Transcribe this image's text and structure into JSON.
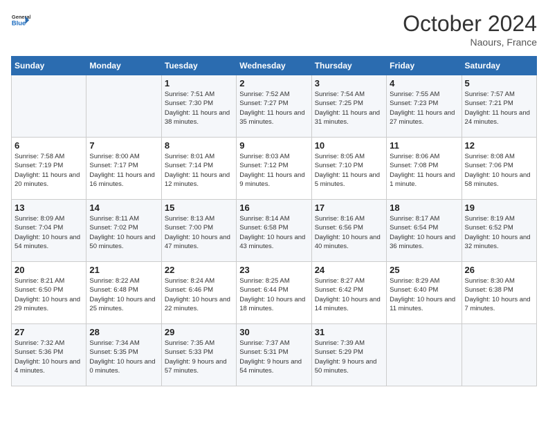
{
  "header": {
    "logo_line1": "General",
    "logo_line2": "Blue",
    "month": "October 2024",
    "location": "Naours, France"
  },
  "days_of_week": [
    "Sunday",
    "Monday",
    "Tuesday",
    "Wednesday",
    "Thursday",
    "Friday",
    "Saturday"
  ],
  "weeks": [
    [
      {
        "day": "",
        "sunrise": "",
        "sunset": "",
        "daylight": ""
      },
      {
        "day": "",
        "sunrise": "",
        "sunset": "",
        "daylight": ""
      },
      {
        "day": "1",
        "sunrise": "Sunrise: 7:51 AM",
        "sunset": "Sunset: 7:30 PM",
        "daylight": "Daylight: 11 hours and 38 minutes."
      },
      {
        "day": "2",
        "sunrise": "Sunrise: 7:52 AM",
        "sunset": "Sunset: 7:27 PM",
        "daylight": "Daylight: 11 hours and 35 minutes."
      },
      {
        "day": "3",
        "sunrise": "Sunrise: 7:54 AM",
        "sunset": "Sunset: 7:25 PM",
        "daylight": "Daylight: 11 hours and 31 minutes."
      },
      {
        "day": "4",
        "sunrise": "Sunrise: 7:55 AM",
        "sunset": "Sunset: 7:23 PM",
        "daylight": "Daylight: 11 hours and 27 minutes."
      },
      {
        "day": "5",
        "sunrise": "Sunrise: 7:57 AM",
        "sunset": "Sunset: 7:21 PM",
        "daylight": "Daylight: 11 hours and 24 minutes."
      }
    ],
    [
      {
        "day": "6",
        "sunrise": "Sunrise: 7:58 AM",
        "sunset": "Sunset: 7:19 PM",
        "daylight": "Daylight: 11 hours and 20 minutes."
      },
      {
        "day": "7",
        "sunrise": "Sunrise: 8:00 AM",
        "sunset": "Sunset: 7:17 PM",
        "daylight": "Daylight: 11 hours and 16 minutes."
      },
      {
        "day": "8",
        "sunrise": "Sunrise: 8:01 AM",
        "sunset": "Sunset: 7:14 PM",
        "daylight": "Daylight: 11 hours and 12 minutes."
      },
      {
        "day": "9",
        "sunrise": "Sunrise: 8:03 AM",
        "sunset": "Sunset: 7:12 PM",
        "daylight": "Daylight: 11 hours and 9 minutes."
      },
      {
        "day": "10",
        "sunrise": "Sunrise: 8:05 AM",
        "sunset": "Sunset: 7:10 PM",
        "daylight": "Daylight: 11 hours and 5 minutes."
      },
      {
        "day": "11",
        "sunrise": "Sunrise: 8:06 AM",
        "sunset": "Sunset: 7:08 PM",
        "daylight": "Daylight: 11 hours and 1 minute."
      },
      {
        "day": "12",
        "sunrise": "Sunrise: 8:08 AM",
        "sunset": "Sunset: 7:06 PM",
        "daylight": "Daylight: 10 hours and 58 minutes."
      }
    ],
    [
      {
        "day": "13",
        "sunrise": "Sunrise: 8:09 AM",
        "sunset": "Sunset: 7:04 PM",
        "daylight": "Daylight: 10 hours and 54 minutes."
      },
      {
        "day": "14",
        "sunrise": "Sunrise: 8:11 AM",
        "sunset": "Sunset: 7:02 PM",
        "daylight": "Daylight: 10 hours and 50 minutes."
      },
      {
        "day": "15",
        "sunrise": "Sunrise: 8:13 AM",
        "sunset": "Sunset: 7:00 PM",
        "daylight": "Daylight: 10 hours and 47 minutes."
      },
      {
        "day": "16",
        "sunrise": "Sunrise: 8:14 AM",
        "sunset": "Sunset: 6:58 PM",
        "daylight": "Daylight: 10 hours and 43 minutes."
      },
      {
        "day": "17",
        "sunrise": "Sunrise: 8:16 AM",
        "sunset": "Sunset: 6:56 PM",
        "daylight": "Daylight: 10 hours and 40 minutes."
      },
      {
        "day": "18",
        "sunrise": "Sunrise: 8:17 AM",
        "sunset": "Sunset: 6:54 PM",
        "daylight": "Daylight: 10 hours and 36 minutes."
      },
      {
        "day": "19",
        "sunrise": "Sunrise: 8:19 AM",
        "sunset": "Sunset: 6:52 PM",
        "daylight": "Daylight: 10 hours and 32 minutes."
      }
    ],
    [
      {
        "day": "20",
        "sunrise": "Sunrise: 8:21 AM",
        "sunset": "Sunset: 6:50 PM",
        "daylight": "Daylight: 10 hours and 29 minutes."
      },
      {
        "day": "21",
        "sunrise": "Sunrise: 8:22 AM",
        "sunset": "Sunset: 6:48 PM",
        "daylight": "Daylight: 10 hours and 25 minutes."
      },
      {
        "day": "22",
        "sunrise": "Sunrise: 8:24 AM",
        "sunset": "Sunset: 6:46 PM",
        "daylight": "Daylight: 10 hours and 22 minutes."
      },
      {
        "day": "23",
        "sunrise": "Sunrise: 8:25 AM",
        "sunset": "Sunset: 6:44 PM",
        "daylight": "Daylight: 10 hours and 18 minutes."
      },
      {
        "day": "24",
        "sunrise": "Sunrise: 8:27 AM",
        "sunset": "Sunset: 6:42 PM",
        "daylight": "Daylight: 10 hours and 14 minutes."
      },
      {
        "day": "25",
        "sunrise": "Sunrise: 8:29 AM",
        "sunset": "Sunset: 6:40 PM",
        "daylight": "Daylight: 10 hours and 11 minutes."
      },
      {
        "day": "26",
        "sunrise": "Sunrise: 8:30 AM",
        "sunset": "Sunset: 6:38 PM",
        "daylight": "Daylight: 10 hours and 7 minutes."
      }
    ],
    [
      {
        "day": "27",
        "sunrise": "Sunrise: 7:32 AM",
        "sunset": "Sunset: 5:36 PM",
        "daylight": "Daylight: 10 hours and 4 minutes."
      },
      {
        "day": "28",
        "sunrise": "Sunrise: 7:34 AM",
        "sunset": "Sunset: 5:35 PM",
        "daylight": "Daylight: 10 hours and 0 minutes."
      },
      {
        "day": "29",
        "sunrise": "Sunrise: 7:35 AM",
        "sunset": "Sunset: 5:33 PM",
        "daylight": "Daylight: 9 hours and 57 minutes."
      },
      {
        "day": "30",
        "sunrise": "Sunrise: 7:37 AM",
        "sunset": "Sunset: 5:31 PM",
        "daylight": "Daylight: 9 hours and 54 minutes."
      },
      {
        "day": "31",
        "sunrise": "Sunrise: 7:39 AM",
        "sunset": "Sunset: 5:29 PM",
        "daylight": "Daylight: 9 hours and 50 minutes."
      },
      {
        "day": "",
        "sunrise": "",
        "sunset": "",
        "daylight": ""
      },
      {
        "day": "",
        "sunrise": "",
        "sunset": "",
        "daylight": ""
      }
    ]
  ]
}
